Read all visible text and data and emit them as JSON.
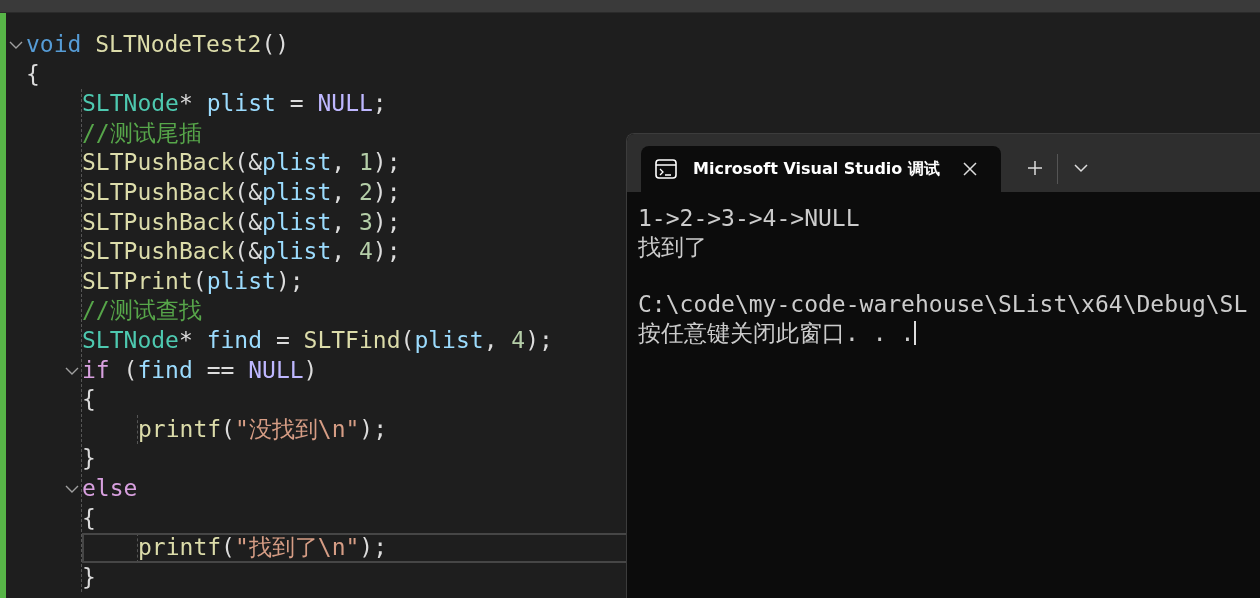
{
  "editor": {
    "lines": [
      {
        "expanded": true,
        "current": false,
        "tokens": [
          {
            "kind": "keyword",
            "text": "void"
          },
          {
            "kind": "function",
            "text": " SLTNodeTest2"
          },
          {
            "kind": "punct",
            "text": "()"
          }
        ]
      },
      {
        "current": false,
        "tokens": [
          {
            "kind": "punct",
            "text": "{"
          }
        ],
        "children": [
          {
            "current": false,
            "tokens": [
              {
                "kind": "type",
                "text": "SLTNode"
              },
              {
                "kind": "punct",
                "text": "* "
              },
              {
                "kind": "variable",
                "text": "plist"
              },
              {
                "kind": "punct",
                "text": " = "
              },
              {
                "kind": "macro",
                "text": "NULL"
              },
              {
                "kind": "punct",
                "text": ";"
              }
            ]
          },
          {
            "current": false,
            "tokens": [
              {
                "kind": "comment",
                "text": "//测试尾插"
              }
            ]
          },
          {
            "current": false,
            "tokens": [
              {
                "kind": "function",
                "text": "SLTPushBack"
              },
              {
                "kind": "punct",
                "text": "(&"
              },
              {
                "kind": "variable",
                "text": "plist"
              },
              {
                "kind": "punct",
                "text": ", "
              },
              {
                "kind": "number",
                "text": "1"
              },
              {
                "kind": "punct",
                "text": ");"
              }
            ]
          },
          {
            "current": false,
            "tokens": [
              {
                "kind": "function",
                "text": "SLTPushBack"
              },
              {
                "kind": "punct",
                "text": "(&"
              },
              {
                "kind": "variable",
                "text": "plist"
              },
              {
                "kind": "punct",
                "text": ", "
              },
              {
                "kind": "number",
                "text": "2"
              },
              {
                "kind": "punct",
                "text": ");"
              }
            ]
          },
          {
            "current": false,
            "tokens": [
              {
                "kind": "function",
                "text": "SLTPushBack"
              },
              {
                "kind": "punct",
                "text": "(&"
              },
              {
                "kind": "variable",
                "text": "plist"
              },
              {
                "kind": "punct",
                "text": ", "
              },
              {
                "kind": "number",
                "text": "3"
              },
              {
                "kind": "punct",
                "text": ");"
              }
            ]
          },
          {
            "current": false,
            "tokens": [
              {
                "kind": "function",
                "text": "SLTPushBack"
              },
              {
                "kind": "punct",
                "text": "(&"
              },
              {
                "kind": "variable",
                "text": "plist"
              },
              {
                "kind": "punct",
                "text": ", "
              },
              {
                "kind": "number",
                "text": "4"
              },
              {
                "kind": "punct",
                "text": ");"
              }
            ]
          },
          {
            "current": false,
            "tokens": [
              {
                "kind": "function",
                "text": "SLTPrint"
              },
              {
                "kind": "punct",
                "text": "("
              },
              {
                "kind": "variable",
                "text": "plist"
              },
              {
                "kind": "punct",
                "text": ");"
              }
            ]
          },
          {
            "current": false,
            "tokens": [
              {
                "kind": "comment",
                "text": "//测试查找"
              }
            ]
          },
          {
            "current": false,
            "tokens": [
              {
                "kind": "type",
                "text": "SLTNode"
              },
              {
                "kind": "punct",
                "text": "* "
              },
              {
                "kind": "variable",
                "text": "find"
              },
              {
                "kind": "punct",
                "text": " = "
              },
              {
                "kind": "function",
                "text": "SLTFind"
              },
              {
                "kind": "punct",
                "text": "("
              },
              {
                "kind": "variable",
                "text": "plist"
              },
              {
                "kind": "punct",
                "text": ", "
              },
              {
                "kind": "number",
                "text": "4"
              },
              {
                "kind": "punct",
                "text": ");"
              }
            ]
          },
          {
            "expanded": true,
            "current": false,
            "tokens": [
              {
                "kind": "control",
                "text": "if"
              },
              {
                "kind": "punct",
                "text": " ("
              },
              {
                "kind": "variable",
                "text": "find"
              },
              {
                "kind": "punct",
                "text": " == "
              },
              {
                "kind": "macro",
                "text": "NULL"
              },
              {
                "kind": "punct",
                "text": ")"
              }
            ]
          },
          {
            "current": false,
            "tokens": [
              {
                "kind": "punct",
                "text": "{"
              }
            ],
            "children": [
              {
                "current": false,
                "tokens": [
                  {
                    "kind": "function",
                    "text": "printf"
                  },
                  {
                    "kind": "punct",
                    "text": "("
                  },
                  {
                    "kind": "string",
                    "text": "\"没找到\\n\""
                  },
                  {
                    "kind": "punct",
                    "text": ");"
                  }
                ]
              }
            ]
          },
          {
            "current": false,
            "tokens": [
              {
                "kind": "punct",
                "text": "}"
              }
            ]
          },
          {
            "expanded": true,
            "current": false,
            "tokens": [
              {
                "kind": "control",
                "text": "else"
              }
            ]
          },
          {
            "current": false,
            "tokens": [
              {
                "kind": "punct",
                "text": "{"
              }
            ],
            "children": [
              {
                "current": true,
                "tokens": [
                  {
                    "kind": "function",
                    "text": "printf"
                  },
                  {
                    "kind": "punct",
                    "text": "("
                  },
                  {
                    "kind": "string",
                    "text": "\"找到了\\n\""
                  },
                  {
                    "kind": "punct",
                    "text": ");"
                  }
                ]
              }
            ]
          },
          {
            "current": false,
            "tokens": [
              {
                "kind": "punct",
                "text": "}"
              }
            ]
          }
        ]
      }
    ]
  },
  "terminal": {
    "tab": {
      "title": "Microsoft Visual Studio 调试"
    },
    "output": [
      [
        "1->2->3->4->NULL",
        "找到了"
      ],
      [
        "C:\\code\\my-code-warehouse\\SList\\x64\\Debug\\SL",
        "按任意键关闭此窗口. . ."
      ]
    ],
    "cursor": true
  }
}
